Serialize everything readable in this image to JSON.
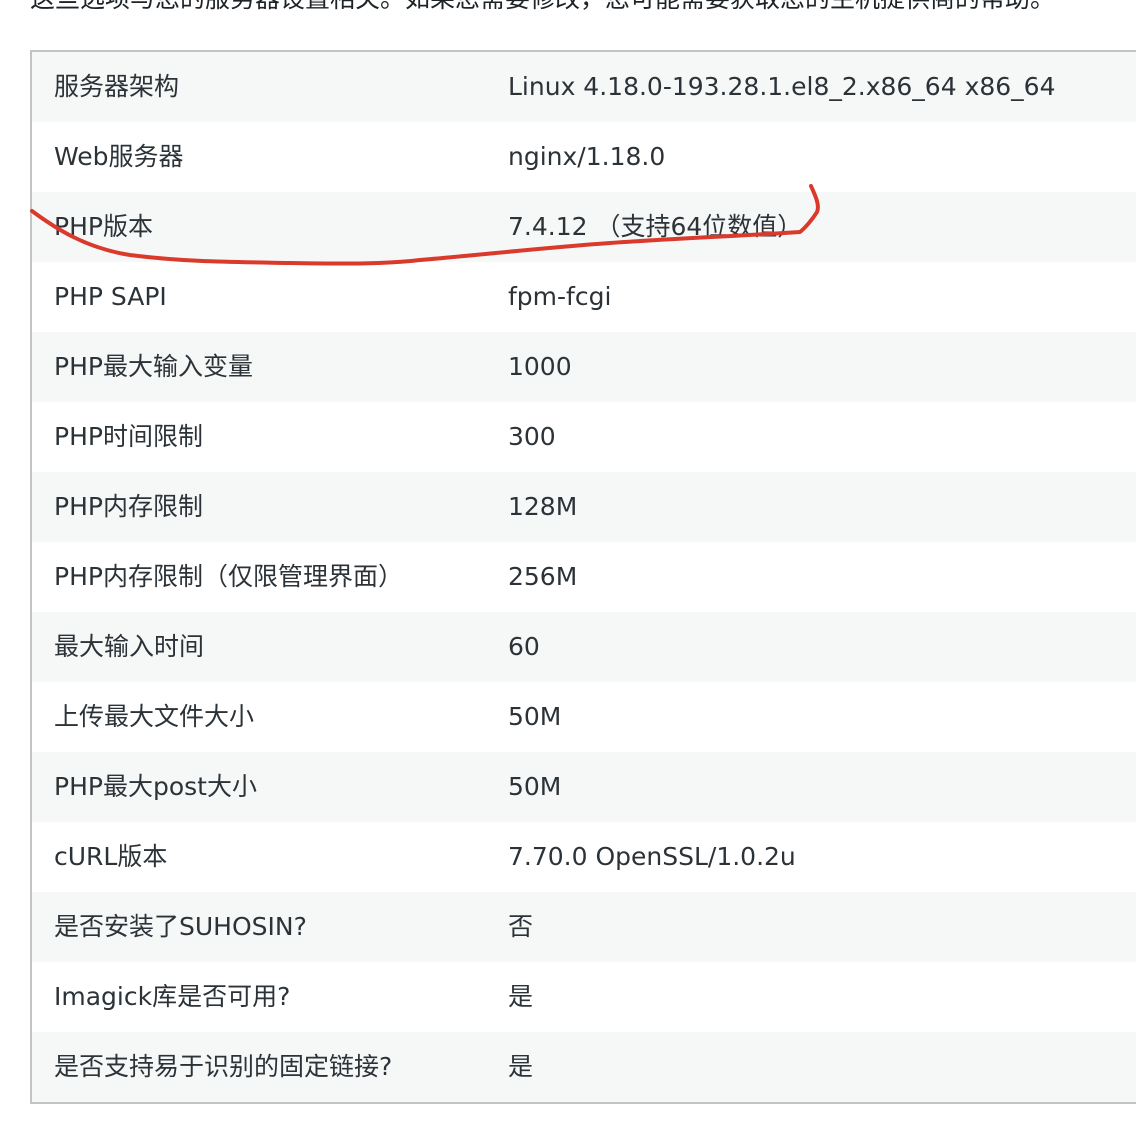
{
  "intro_text": "这些选项与您的服务器设置相关。如果您需要修改，您可能需要获取您的主机提供商的帮助。",
  "rows": [
    {
      "label": "服务器架构",
      "value": "Linux 4.18.0-193.28.1.el8_2.x86_64 x86_64"
    },
    {
      "label": "Web服务器",
      "value": "nginx/1.18.0"
    },
    {
      "label": "PHP版本",
      "value": "7.4.12 （支持64位数值）"
    },
    {
      "label": "PHP SAPI",
      "value": "fpm-fcgi"
    },
    {
      "label": "PHP最大输入变量",
      "value": "1000"
    },
    {
      "label": "PHP时间限制",
      "value": "300"
    },
    {
      "label": "PHP内存限制",
      "value": "128M"
    },
    {
      "label": "PHP内存限制（仅限管理界面）",
      "value": "256M"
    },
    {
      "label": "最大输入时间",
      "value": "60"
    },
    {
      "label": "上传最大文件大小",
      "value": "50M"
    },
    {
      "label": "PHP最大post大小",
      "value": "50M"
    },
    {
      "label": "cURL版本",
      "value": "7.70.0 OpenSSL/1.0.2u"
    },
    {
      "label": "是否安装了SUHOSIN?",
      "value": "否"
    },
    {
      "label": "Imagick库是否可用?",
      "value": "是"
    },
    {
      "label": "是否支持易于识别的固定链接?",
      "value": "是"
    }
  ],
  "colors": {
    "annotation": "#d93a2b",
    "row_stripe": "#f6f7f7",
    "border": "#c3c4c7",
    "text": "#2c3338"
  }
}
